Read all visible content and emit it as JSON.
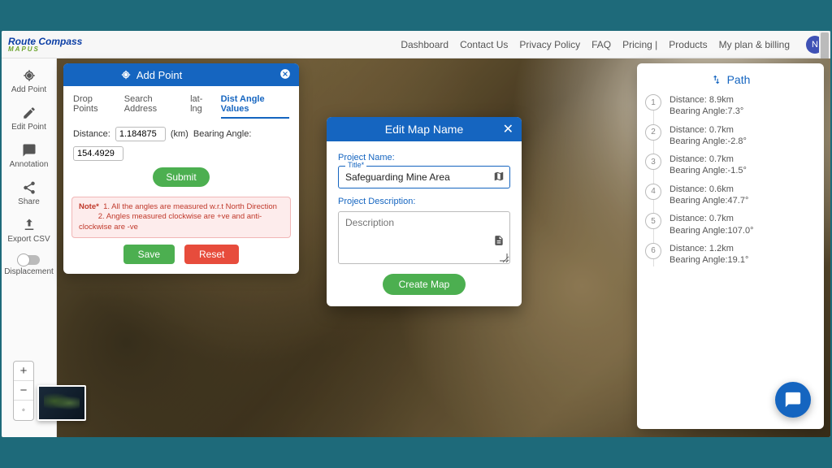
{
  "brand": {
    "main": "Route Compass",
    "sub": "MAPUS"
  },
  "nav": {
    "items": [
      "Dashboard",
      "Contact Us",
      "Privacy Policy",
      "FAQ",
      "Pricing |",
      "Products",
      "My plan & billing"
    ],
    "avatar": "N"
  },
  "sidebar": {
    "items": [
      {
        "label": "Add Point"
      },
      {
        "label": "Edit Point"
      },
      {
        "label": "Annotation"
      },
      {
        "label": "Share"
      },
      {
        "label": "Export CSV"
      },
      {
        "label": "Displacement"
      }
    ]
  },
  "add_point": {
    "title": "Add Point",
    "tabs": [
      "Drop Points",
      "Search Address",
      "lat-lng",
      "Dist Angle Values"
    ],
    "active_tab_index": 3,
    "distance_label": "Distance:",
    "distance_value": "1.184875",
    "unit": "(km)",
    "bearing_label": "Bearing Angle:",
    "bearing_value": "154.4929",
    "submit": "Submit",
    "note_label": "Note*",
    "note_1": "1. All the angles are measured w.r.t North Direction",
    "note_2": "2. Angles measured clockwise are +ve and anti-clockwise are -ve",
    "save": "Save",
    "reset": "Reset"
  },
  "modal": {
    "title": "Edit Map Name",
    "project_name_label": "Project Name:",
    "title_float": "Title*",
    "title_value": "Safeguarding Mine Area",
    "desc_label": "Project Description:",
    "desc_placeholder": "Description",
    "create": "Create Map"
  },
  "path": {
    "title": "Path",
    "items": [
      {
        "n": "1",
        "distance": "Distance: 8.9km",
        "bearing": "Bearing Angle:7.3°"
      },
      {
        "n": "2",
        "distance": "Distance: 0.7km",
        "bearing": "Bearing Angle:-2.8°"
      },
      {
        "n": "3",
        "distance": "Distance: 0.7km",
        "bearing": "Bearing Angle:-1.5°"
      },
      {
        "n": "4",
        "distance": "Distance: 0.6km",
        "bearing": "Bearing Angle:47.7°"
      },
      {
        "n": "5",
        "distance": "Distance: 0.7km",
        "bearing": "Bearing Angle:107.0°"
      },
      {
        "n": "6",
        "distance": "Distance: 1.2km",
        "bearing": "Bearing Angle:19.1°"
      }
    ]
  },
  "zoom": {
    "plus": "+",
    "minus": "−",
    "reset": "◦"
  }
}
